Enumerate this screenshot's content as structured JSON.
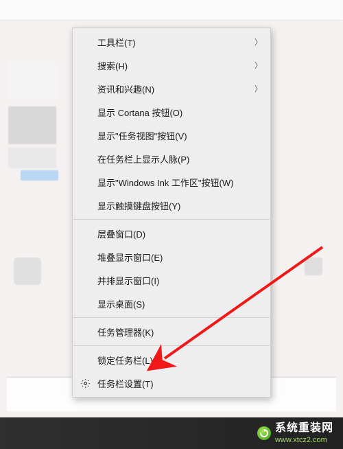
{
  "menu": {
    "groups": [
      [
        {
          "id": "toolbar",
          "label": "工具栏(T)",
          "submenu": true
        },
        {
          "id": "search",
          "label": "搜索(H)",
          "submenu": true
        },
        {
          "id": "news",
          "label": "资讯和兴趣(N)",
          "submenu": true
        },
        {
          "id": "cortana",
          "label": "显示 Cortana 按钮(O)"
        },
        {
          "id": "taskview",
          "label": "显示\"任务视图\"按钮(V)"
        },
        {
          "id": "people",
          "label": "在任务栏上显示人脉(P)"
        },
        {
          "id": "ink",
          "label": "显示\"Windows Ink 工作区\"按钮(W)"
        },
        {
          "id": "touchkb",
          "label": "显示触摸键盘按钮(Y)"
        }
      ],
      [
        {
          "id": "cascade",
          "label": "层叠窗口(D)"
        },
        {
          "id": "stacked",
          "label": "堆叠显示窗口(E)"
        },
        {
          "id": "sidebyside",
          "label": "并排显示窗口(I)"
        },
        {
          "id": "showdesktop",
          "label": "显示桌面(S)"
        }
      ],
      [
        {
          "id": "taskmanager",
          "label": "任务管理器(K)"
        }
      ],
      [
        {
          "id": "lock",
          "label": "锁定任务栏(L)"
        },
        {
          "id": "settings",
          "label": "任务栏设置(T)",
          "icon": "gear"
        }
      ]
    ]
  },
  "watermark": {
    "brand": "系统重装网",
    "url": "www.xtcz2.com"
  },
  "annotation": {
    "arrow_target": "taskmanager",
    "arrow_color": "#f01818"
  }
}
